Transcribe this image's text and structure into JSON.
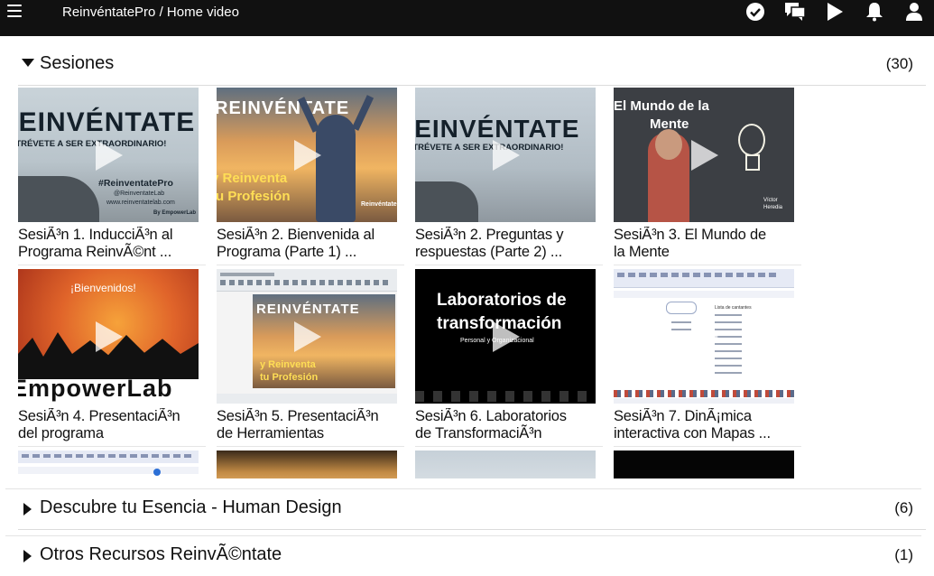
{
  "header": {
    "breadcrumb": "ReinvéntatePro / Home video",
    "icons": [
      "menu-icon",
      "check-circle-icon",
      "chat-icon",
      "play-icon",
      "bell-icon",
      "user-icon"
    ]
  },
  "sections": [
    {
      "title": "Sesiones",
      "count": "(30)",
      "expanded": true
    },
    {
      "title": "Descubre tu Esencia - Human Design",
      "count": "(6)",
      "expanded": false
    },
    {
      "title": "Otros Recursos ReinvÃ©ntate",
      "count": "(1)",
      "expanded": false
    }
  ],
  "cards": [
    {
      "line1": "SesiÃ³n 1. InducciÃ³n al",
      "line2": "Programa ReinvÃ©nt ...",
      "thumb": {
        "big": "Reinvéntate",
        "sub": "¡ATRÉVETE A SER EXTRAORDINARIO!",
        "hashtag": "#ReinventatePro",
        "handle": "@ReinventateLab",
        "site": "www.reinventatelab.com",
        "by": "By EmpowerLab"
      }
    },
    {
      "line1": "SesiÃ³n 2. Bienvenida al",
      "line2": "Programa (Parte 1) ...",
      "thumb": {
        "big": "Reinvéntate",
        "slogan1": "y Reinventa",
        "slogan2": "tu Profesión",
        "brand": "Reinvéntate"
      }
    },
    {
      "line1": "SesiÃ³n 2. Preguntas y",
      "line2": "respuestas (Parte 2) ...",
      "thumb": {
        "big": "Reinvéntate",
        "sub": "¡ATRÉVETE A SER EXTRAORDINARIO!"
      }
    },
    {
      "line1": "SesiÃ³n 3. El Mundo de",
      "line2": "la Mente",
      "thumb": {
        "title1": "El Mundo de la",
        "title2": "Mente",
        "name1": "Víctor",
        "name2": "Heredia"
      }
    },
    {
      "line1": "SesiÃ³n 4. PresentaciÃ³n",
      "line2": "del programa",
      "thumb": {
        "welcome": "¡Bienvenidos!",
        "brand": "EmpowerLab"
      }
    },
    {
      "line1": "SesiÃ³n 5. PresentaciÃ³n",
      "line2": "de Herramientas",
      "thumb": {
        "big": "Reinvéntate",
        "slogan1": "y Reinventa",
        "slogan2": "tu Profesión"
      }
    },
    {
      "line1": "SesiÃ³n 6. Laboratorios",
      "line2": "de TransformaciÃ³n",
      "thumb": {
        "title1": "Laboratorios de",
        "title2": "transformación",
        "sub": "Personal y Organizacional"
      }
    },
    {
      "line1": "SesiÃ³n 7. DinÃ¡mica",
      "line2": "interactiva con Mapas ...",
      "thumb": {
        "heading": "Lista de cantantes"
      }
    }
  ],
  "colors": {
    "topbar": "#111111",
    "text": "#111111",
    "divider": "#dcdcdc"
  }
}
